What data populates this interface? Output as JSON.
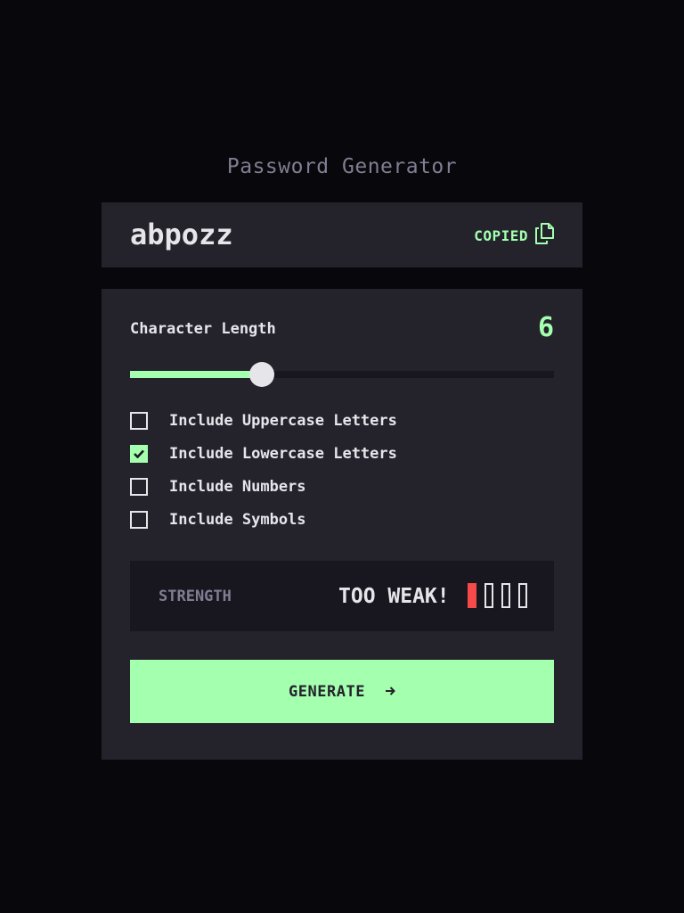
{
  "app": {
    "title": "Password Generator"
  },
  "password": {
    "value": "abpozz",
    "copied_label": "COPIED",
    "copy_icon": "copy-icon"
  },
  "length": {
    "label": "Character Length",
    "value": 6,
    "value_text": "6",
    "slider_fraction": 0.31
  },
  "options": [
    {
      "label": "Include Uppercase Letters",
      "checked": false
    },
    {
      "label": "Include Lowercase Letters",
      "checked": true
    },
    {
      "label": "Include Numbers",
      "checked": false
    },
    {
      "label": "Include Symbols",
      "checked": false
    }
  ],
  "strength": {
    "label": "STRENGTH",
    "value": "TOO WEAK!",
    "level": 1,
    "max_level": 4
  },
  "generate": {
    "label": "GENERATE",
    "icon": "arrow-right-icon"
  },
  "colors": {
    "accent": "#a4ffaf",
    "weak": "#f64a4a",
    "panel": "#24232c",
    "background": "#08070b",
    "muted": "#817d92",
    "text": "#e6e5ea"
  }
}
